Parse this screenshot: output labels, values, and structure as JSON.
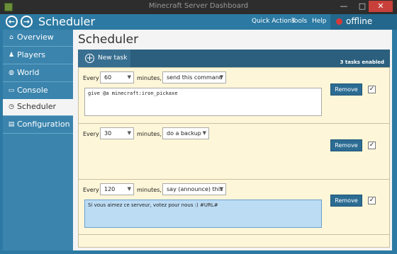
{
  "window": {
    "title": "Minecraft Server Dashboard",
    "minimize": "—",
    "maximize": "□",
    "close": "✕"
  },
  "header": {
    "title": "Scheduler",
    "back": "←",
    "forward": "→",
    "menu": [
      "Quick Actions",
      "Tools",
      "Help"
    ],
    "status": "offline"
  },
  "sidebar": {
    "items": [
      {
        "label": "Overview",
        "icon": "home-icon",
        "glyph": "⌂"
      },
      {
        "label": "Players",
        "icon": "person-icon",
        "glyph": "♟"
      },
      {
        "label": "World",
        "icon": "globe-icon",
        "glyph": "◍"
      },
      {
        "label": "Console",
        "icon": "terminal-icon",
        "glyph": "▭"
      },
      {
        "label": "Scheduler",
        "icon": "clock-icon",
        "glyph": "◷",
        "active": true
      },
      {
        "label": "Configuration",
        "icon": "settings-icon",
        "glyph": "▤"
      }
    ]
  },
  "main": {
    "title": "Scheduler",
    "new_task": "New task",
    "tasks_enabled": "3 tasks enabled",
    "every_label": "Every",
    "minutes_label": "minutes,",
    "remove_label": "Remove",
    "tasks": [
      {
        "interval": "60",
        "action": "send this command",
        "text": "give @a minecraft:iron_pickaxe",
        "enabled": true
      },
      {
        "interval": "30",
        "action": "do a backup",
        "text": "",
        "enabled": true
      },
      {
        "interval": "120",
        "action": "say (announce) this",
        "text": "Si vous aimez ce serveur, votez pour nous :) #URL#",
        "enabled": true
      }
    ]
  },
  "colors": {
    "accent": "#2c7aa3",
    "panel": "#fdf6d8",
    "status_offline": "#d43a3a"
  }
}
